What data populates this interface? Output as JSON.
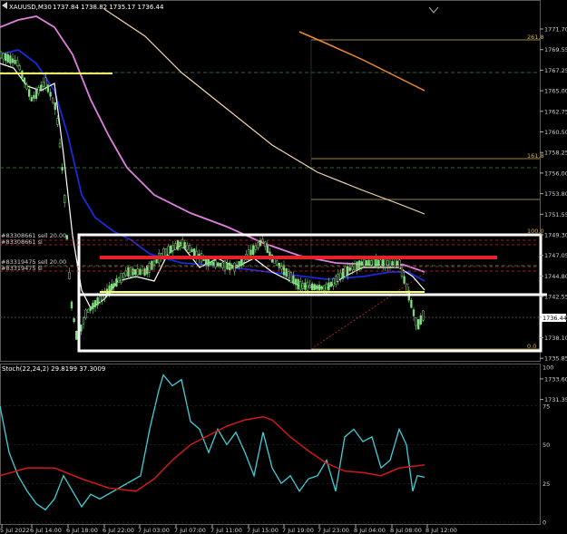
{
  "window": {
    "symbol_title": "XAUUSD,M30",
    "ohlc": "1737.84 1738.82 1735.17 1736.44"
  },
  "price_axis": {
    "ticks": [
      "1771.70",
      "1769.55",
      "1767.25",
      "1765.00",
      "1762.75",
      "1760.50",
      "1758.25",
      "1756.00",
      "1753.80",
      "1751.55",
      "1749.30",
      "1747.05",
      "1744.80",
      "1742.55",
      "1740.35",
      "1738.10",
      "1735.85",
      "1733.60",
      "1731.35"
    ],
    "current_price": "1736.44",
    "current_price_color": "#ffffff"
  },
  "fib_levels": [
    "261.8",
    "161.8",
    "100.0",
    "0.0"
  ],
  "order_labels": [
    "#83308661 sell 20.00",
    "#83308661 sl",
    "#83319475 sell 20.00",
    "#83319475 sl"
  ],
  "indicator": {
    "title": "Stoch(22,24,2) 29.8199 37.3009",
    "scale": [
      "100",
      "75",
      "50",
      "25",
      "0"
    ],
    "main_color": "#3fd0d8",
    "signal_color": "#d01818"
  },
  "time_axis": {
    "labels": [
      "5 Jul 2022",
      "6 Jul 14:00",
      "6 Jul 18:00",
      "6 Jul 22:00",
      "7 Jul 03:00",
      "7 Jul 07:00",
      "7 Jul 11:00",
      "7 Jul 15:00",
      "7 Jul 19:00",
      "7 Jul 23:00",
      "8 Jul 04:00",
      "8 Jul 08:00",
      "8 Jul 12:00"
    ]
  },
  "colors": {
    "background": "#000000",
    "candle": "#7fe07f",
    "ma_white": "#ffffff",
    "ma_blue": "#1a2ad8",
    "ma_pink": "#e07fe0",
    "ma_peach": "#f5d5b0",
    "ma_orange": "#f08a30",
    "zone_red": "#e8202a",
    "zone_yellow": "#ffff66",
    "box_white": "#ffffff"
  }
}
